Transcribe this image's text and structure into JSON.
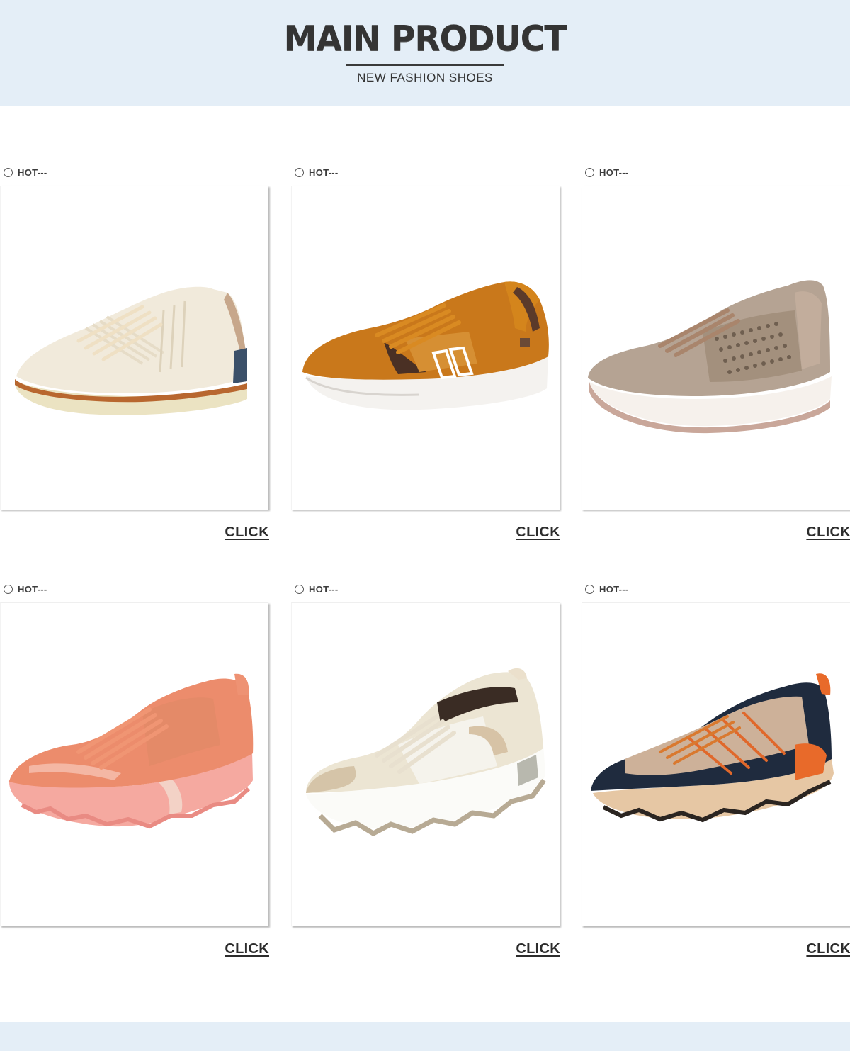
{
  "header": {
    "title": "MAIN PRODUCT",
    "subtitle": "NEW FASHION SHOES"
  },
  "products": [
    {
      "badge": "HOT---",
      "link_label": "CLICK",
      "image": "white-leather-sneaker"
    },
    {
      "badge": "HOT---",
      "link_label": "CLICK",
      "image": "tan-suede-running-shoe"
    },
    {
      "badge": "HOT---",
      "link_label": "CLICK",
      "image": "metallic-perforated-sneaker"
    },
    {
      "badge": "HOT---",
      "link_label": "CLICK",
      "image": "coral-chunky-sneaker"
    },
    {
      "badge": "HOT---",
      "link_label": "CLICK",
      "image": "beige-chunky-sneaker"
    },
    {
      "badge": "HOT---",
      "link_label": "CLICK",
      "image": "navy-orange-trail-shoe"
    }
  ],
  "colors": {
    "header_bg": "#e4eef7",
    "text": "#333333"
  }
}
